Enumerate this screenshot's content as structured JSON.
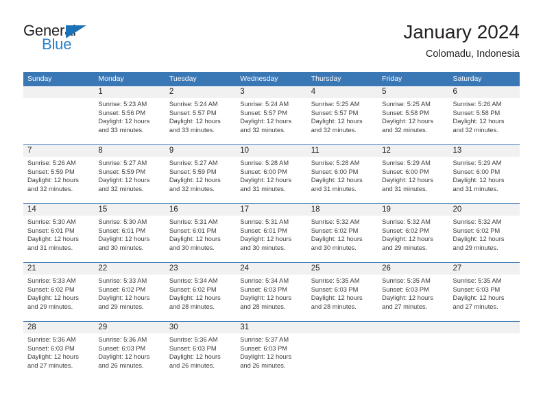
{
  "brand": {
    "logo_text_top": "General",
    "logo_text_bottom": "Blue",
    "logo_icon": "triangle-icon",
    "color_blue": "#2981c8",
    "color_triangle": "#1a72b8"
  },
  "header": {
    "title": "January 2024",
    "subtitle": "Colomadu, Indonesia"
  },
  "theme": {
    "header_bg": "#3a77b5",
    "daynum_bg": "#f1f1f1",
    "separator": "#3a77b5"
  },
  "columns": [
    "Sunday",
    "Monday",
    "Tuesday",
    "Wednesday",
    "Thursday",
    "Friday",
    "Saturday"
  ],
  "labels": {
    "sunrise_prefix": "Sunrise:",
    "sunset_prefix": "Sunset:",
    "daylight_prefix": "Daylight:"
  },
  "weeks": [
    [
      {
        "day": "",
        "blank": true
      },
      {
        "day": "1",
        "sunrise": "Sunrise: 5:23 AM",
        "sunset": "Sunset: 5:56 PM",
        "daylight": "Daylight: 12 hours and 33 minutes."
      },
      {
        "day": "2",
        "sunrise": "Sunrise: 5:24 AM",
        "sunset": "Sunset: 5:57 PM",
        "daylight": "Daylight: 12 hours and 33 minutes."
      },
      {
        "day": "3",
        "sunrise": "Sunrise: 5:24 AM",
        "sunset": "Sunset: 5:57 PM",
        "daylight": "Daylight: 12 hours and 32 minutes."
      },
      {
        "day": "4",
        "sunrise": "Sunrise: 5:25 AM",
        "sunset": "Sunset: 5:57 PM",
        "daylight": "Daylight: 12 hours and 32 minutes."
      },
      {
        "day": "5",
        "sunrise": "Sunrise: 5:25 AM",
        "sunset": "Sunset: 5:58 PM",
        "daylight": "Daylight: 12 hours and 32 minutes."
      },
      {
        "day": "6",
        "sunrise": "Sunrise: 5:26 AM",
        "sunset": "Sunset: 5:58 PM",
        "daylight": "Daylight: 12 hours and 32 minutes."
      }
    ],
    [
      {
        "day": "7",
        "sunrise": "Sunrise: 5:26 AM",
        "sunset": "Sunset: 5:59 PM",
        "daylight": "Daylight: 12 hours and 32 minutes."
      },
      {
        "day": "8",
        "sunrise": "Sunrise: 5:27 AM",
        "sunset": "Sunset: 5:59 PM",
        "daylight": "Daylight: 12 hours and 32 minutes."
      },
      {
        "day": "9",
        "sunrise": "Sunrise: 5:27 AM",
        "sunset": "Sunset: 5:59 PM",
        "daylight": "Daylight: 12 hours and 32 minutes."
      },
      {
        "day": "10",
        "sunrise": "Sunrise: 5:28 AM",
        "sunset": "Sunset: 6:00 PM",
        "daylight": "Daylight: 12 hours and 31 minutes."
      },
      {
        "day": "11",
        "sunrise": "Sunrise: 5:28 AM",
        "sunset": "Sunset: 6:00 PM",
        "daylight": "Daylight: 12 hours and 31 minutes."
      },
      {
        "day": "12",
        "sunrise": "Sunrise: 5:29 AM",
        "sunset": "Sunset: 6:00 PM",
        "daylight": "Daylight: 12 hours and 31 minutes."
      },
      {
        "day": "13",
        "sunrise": "Sunrise: 5:29 AM",
        "sunset": "Sunset: 6:00 PM",
        "daylight": "Daylight: 12 hours and 31 minutes."
      }
    ],
    [
      {
        "day": "14",
        "sunrise": "Sunrise: 5:30 AM",
        "sunset": "Sunset: 6:01 PM",
        "daylight": "Daylight: 12 hours and 31 minutes."
      },
      {
        "day": "15",
        "sunrise": "Sunrise: 5:30 AM",
        "sunset": "Sunset: 6:01 PM",
        "daylight": "Daylight: 12 hours and 30 minutes."
      },
      {
        "day": "16",
        "sunrise": "Sunrise: 5:31 AM",
        "sunset": "Sunset: 6:01 PM",
        "daylight": "Daylight: 12 hours and 30 minutes."
      },
      {
        "day": "17",
        "sunrise": "Sunrise: 5:31 AM",
        "sunset": "Sunset: 6:01 PM",
        "daylight": "Daylight: 12 hours and 30 minutes."
      },
      {
        "day": "18",
        "sunrise": "Sunrise: 5:32 AM",
        "sunset": "Sunset: 6:02 PM",
        "daylight": "Daylight: 12 hours and 30 minutes."
      },
      {
        "day": "19",
        "sunrise": "Sunrise: 5:32 AM",
        "sunset": "Sunset: 6:02 PM",
        "daylight": "Daylight: 12 hours and 29 minutes."
      },
      {
        "day": "20",
        "sunrise": "Sunrise: 5:32 AM",
        "sunset": "Sunset: 6:02 PM",
        "daylight": "Daylight: 12 hours and 29 minutes."
      }
    ],
    [
      {
        "day": "21",
        "sunrise": "Sunrise: 5:33 AM",
        "sunset": "Sunset: 6:02 PM",
        "daylight": "Daylight: 12 hours and 29 minutes."
      },
      {
        "day": "22",
        "sunrise": "Sunrise: 5:33 AM",
        "sunset": "Sunset: 6:02 PM",
        "daylight": "Daylight: 12 hours and 29 minutes."
      },
      {
        "day": "23",
        "sunrise": "Sunrise: 5:34 AM",
        "sunset": "Sunset: 6:02 PM",
        "daylight": "Daylight: 12 hours and 28 minutes."
      },
      {
        "day": "24",
        "sunrise": "Sunrise: 5:34 AM",
        "sunset": "Sunset: 6:03 PM",
        "daylight": "Daylight: 12 hours and 28 minutes."
      },
      {
        "day": "25",
        "sunrise": "Sunrise: 5:35 AM",
        "sunset": "Sunset: 6:03 PM",
        "daylight": "Daylight: 12 hours and 28 minutes."
      },
      {
        "day": "26",
        "sunrise": "Sunrise: 5:35 AM",
        "sunset": "Sunset: 6:03 PM",
        "daylight": "Daylight: 12 hours and 27 minutes."
      },
      {
        "day": "27",
        "sunrise": "Sunrise: 5:35 AM",
        "sunset": "Sunset: 6:03 PM",
        "daylight": "Daylight: 12 hours and 27 minutes."
      }
    ],
    [
      {
        "day": "28",
        "sunrise": "Sunrise: 5:36 AM",
        "sunset": "Sunset: 6:03 PM",
        "daylight": "Daylight: 12 hours and 27 minutes."
      },
      {
        "day": "29",
        "sunrise": "Sunrise: 5:36 AM",
        "sunset": "Sunset: 6:03 PM",
        "daylight": "Daylight: 12 hours and 26 minutes."
      },
      {
        "day": "30",
        "sunrise": "Sunrise: 5:36 AM",
        "sunset": "Sunset: 6:03 PM",
        "daylight": "Daylight: 12 hours and 26 minutes."
      },
      {
        "day": "31",
        "sunrise": "Sunrise: 5:37 AM",
        "sunset": "Sunset: 6:03 PM",
        "daylight": "Daylight: 12 hours and 26 minutes."
      },
      {
        "day": "",
        "blank": true
      },
      {
        "day": "",
        "blank": true
      },
      {
        "day": "",
        "blank": true
      }
    ]
  ]
}
